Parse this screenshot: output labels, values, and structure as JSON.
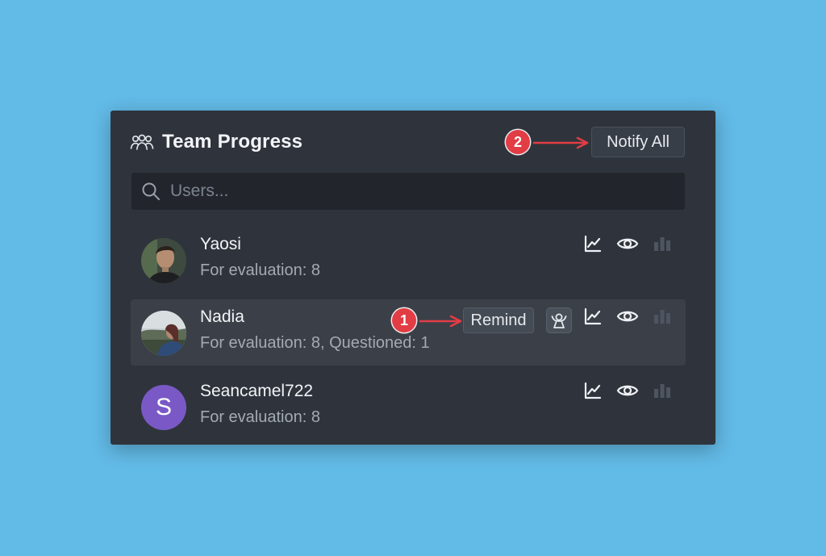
{
  "panel": {
    "title": "Team Progress",
    "header_icon": "team-icon",
    "notify_all_label": "Notify All",
    "search": {
      "placeholder": "Users...",
      "value": "",
      "icon": "search-icon"
    }
  },
  "users": [
    {
      "name": "Yaosi",
      "details": "For evaluation: 8",
      "avatar": "photo"
    },
    {
      "name": "Nadia",
      "details": "For evaluation: 8, Questioned: 1",
      "avatar": "photo",
      "remind_label": "Remind"
    },
    {
      "name": "Seancamel722",
      "details": "For evaluation: 8",
      "avatar_letter": "S"
    }
  ],
  "row_actions": [
    "chart-line-icon",
    "eye-icon",
    "bar-chart-icon"
  ],
  "callouts": [
    {
      "number": "1",
      "target": "remind-button"
    },
    {
      "number": "2",
      "target": "notify-all-button"
    }
  ],
  "colors": {
    "background": "#62BAE6",
    "panel": "#2F343C",
    "row_highlight": "#3A3F48",
    "callout": "#E23C45",
    "avatar_s": "#7A59C6"
  }
}
